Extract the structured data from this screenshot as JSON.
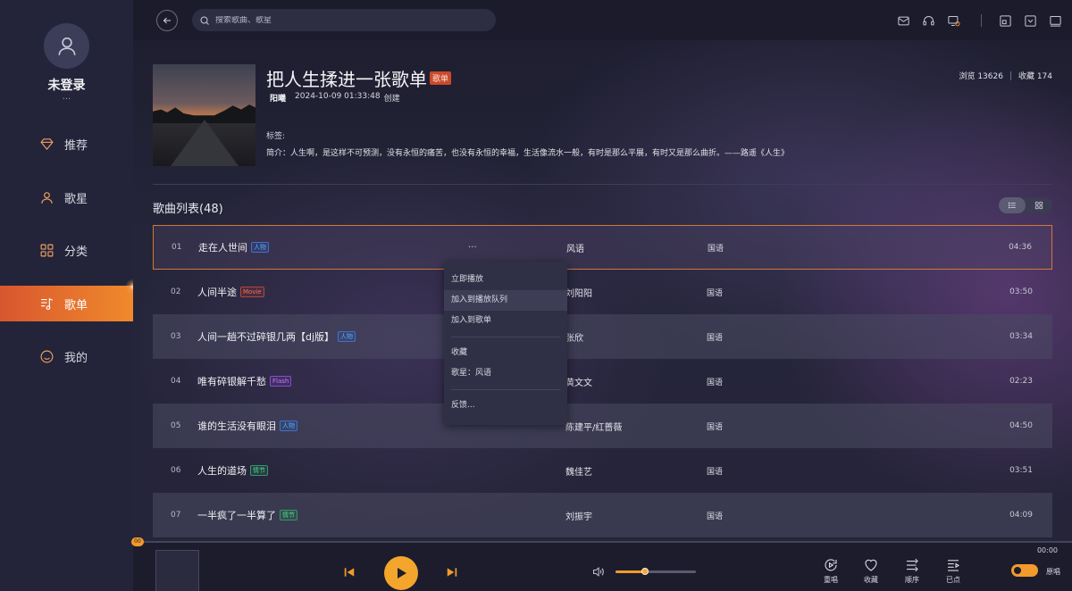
{
  "sidebar": {
    "user_name": "未登录",
    "user_sub": "...",
    "items": [
      {
        "label": "推荐",
        "icon": "diamond-icon"
      },
      {
        "label": "歌星",
        "icon": "person-icon"
      },
      {
        "label": "分类",
        "icon": "grid-icon"
      },
      {
        "label": "歌单",
        "icon": "playlist-icon",
        "active": true
      },
      {
        "label": "我的",
        "icon": "smile-icon"
      }
    ]
  },
  "search": {
    "placeholder": "搜索歌曲、歌星"
  },
  "playlist": {
    "title": "把人生揉进一张歌单",
    "badge": "歌单",
    "creator": "阳曦",
    "created_at": "2024-10-09 01:33:48",
    "created_suffix": "创建",
    "views": "浏览 13626",
    "favorites": "收藏 174",
    "tags_label": "标签:",
    "description": "简介：人生啊，是这样不可预测，没有永恒的痛苦，也没有永恒的幸福，生活像流水一般，有时是那么平展，有时又是那么曲折。——路遥《人生》"
  },
  "song_list": {
    "title": "歌曲列表(48)",
    "songs": [
      {
        "num": "01",
        "title": "走在人世间",
        "tag": "人物",
        "tag_color": "blue",
        "artist": "风语",
        "lang": "国语",
        "duration": "04:36"
      },
      {
        "num": "02",
        "title": "人间半途",
        "tag": "Movie",
        "tag_color": "red",
        "artist": "刘阳阳",
        "lang": "国语",
        "duration": "03:50"
      },
      {
        "num": "03",
        "title": "人间一趟不过碎银几两【dj版】",
        "tag": "人物",
        "tag_color": "blue",
        "artist": "张欣",
        "lang": "国语",
        "duration": "03:34"
      },
      {
        "num": "04",
        "title": "唯有碎银解千愁",
        "tag": "Flash",
        "tag_color": "purple",
        "artist": "黄文文",
        "lang": "国语",
        "duration": "02:23"
      },
      {
        "num": "05",
        "title": "谁的生活没有眼泪",
        "tag": "人物",
        "tag_color": "blue",
        "artist": "陈建平/红蔷薇",
        "lang": "国语",
        "duration": "04:50"
      },
      {
        "num": "06",
        "title": "人生的道场",
        "tag": "情节",
        "tag_color": "green",
        "artist": "魏佳艺",
        "lang": "国语",
        "duration": "03:51"
      },
      {
        "num": "07",
        "title": "一半疯了一半算了",
        "tag": "情节",
        "tag_color": "green",
        "artist": "刘振宇",
        "lang": "国语",
        "duration": "04:09"
      }
    ],
    "more_label": "..."
  },
  "context_menu": {
    "items": [
      "立即播放",
      "加入到播放队列",
      "加入到歌单",
      "收藏",
      "歌星：风语",
      "反馈..."
    ]
  },
  "player": {
    "elapsed": "00",
    "total_time": "00:00",
    "volume_fraction": 0.37,
    "actions": [
      "重唱",
      "收藏",
      "顺序",
      "已点"
    ],
    "toggle_label": "原唱"
  },
  "colors": {
    "accent": "#f39a2c",
    "active_nav": "#e06a2e",
    "background": "#1c1c2c"
  }
}
